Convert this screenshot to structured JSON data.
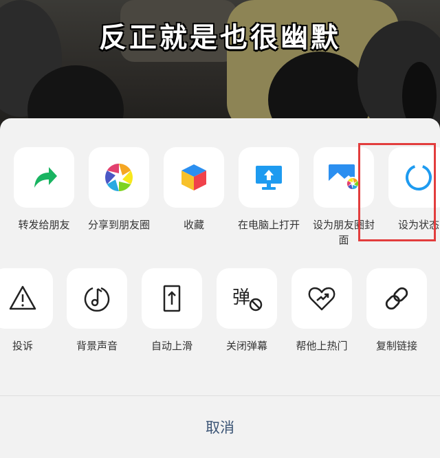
{
  "video": {
    "subtitle": "反正就是也很幽默"
  },
  "share_row": [
    {
      "label": "转发给朋友",
      "icon": "forward-arrow-icon"
    },
    {
      "label": "分享到朋友圈",
      "icon": "moments-aperture-icon"
    },
    {
      "label": "收藏",
      "icon": "favorites-cube-icon"
    },
    {
      "label": "在电脑上打开",
      "icon": "computer-upload-icon"
    },
    {
      "label": "设为朋友圈封面",
      "icon": "image-aperture-icon"
    },
    {
      "label": "设为状态",
      "icon": "status-ring-icon"
    }
  ],
  "action_row": [
    {
      "label": "投诉",
      "icon": "warning-triangle-icon"
    },
    {
      "label": "背景声音",
      "icon": "music-note-icon"
    },
    {
      "label": "自动上滑",
      "icon": "auto-scroll-icon"
    },
    {
      "label": "关闭弹幕",
      "icon": "danmaku-off-icon"
    },
    {
      "label": "帮他上热门",
      "icon": "heart-boost-icon"
    },
    {
      "label": "复制链接",
      "icon": "link-icon"
    }
  ],
  "cancel_label": "取消",
  "colors": {
    "highlight": "#e23d3d",
    "cancel_text": "#3b5475",
    "sheet_bg": "#f2f2f2"
  }
}
